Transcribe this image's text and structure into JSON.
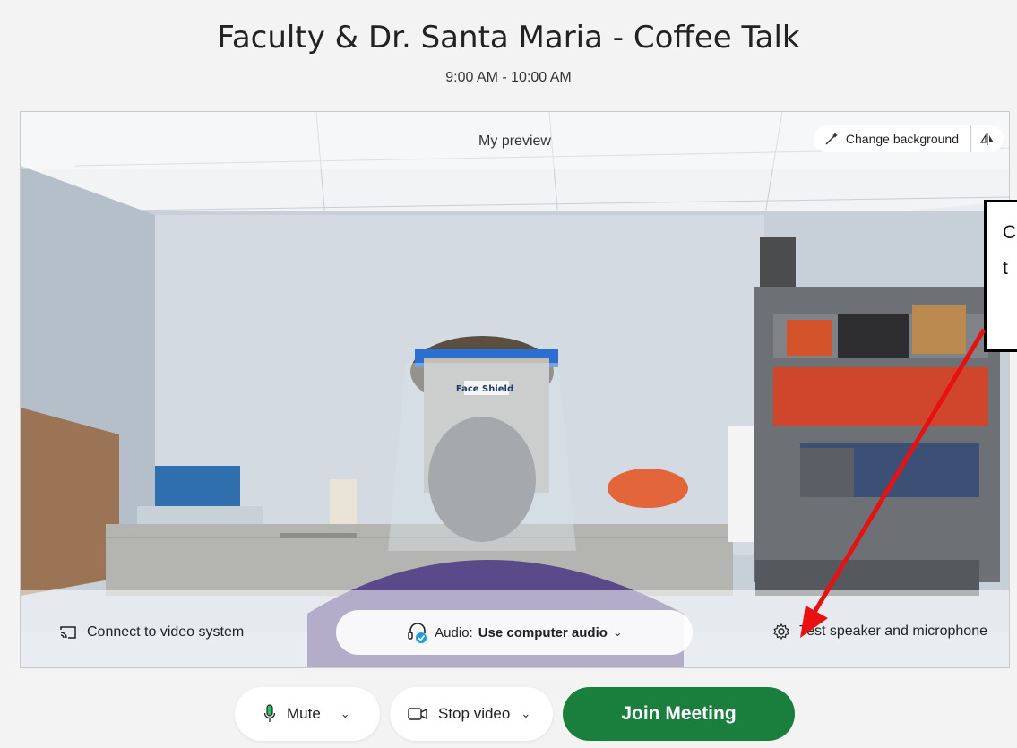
{
  "meeting": {
    "title": "Faculty & Dr. Santa Maria - Coffee Talk",
    "time": "9:00 AM - 10:00 AM"
  },
  "preview": {
    "label": "My preview",
    "change_background_label": "Change background",
    "mask_text": "Face Shield"
  },
  "footer": {
    "connect_label": "Connect to video system",
    "audio_prefix": "Audio:",
    "audio_value": "Use computer audio",
    "test_label": "Test speaker and microphone"
  },
  "controls": {
    "mute_label": "Mute",
    "stop_video_label": "Stop video",
    "join_label": "Join Meeting"
  },
  "callout": {
    "line1": "C",
    "line2": "t"
  },
  "colors": {
    "join_green": "#1a7f3c",
    "arrow_red": "#e81010",
    "audio_badge_blue": "#1e9be3"
  },
  "icons": [
    "magic-wand-icon",
    "mirror-icon",
    "cast-icon",
    "headset-icon",
    "gear-icon",
    "microphone-icon",
    "camera-icon",
    "chevron-down-icon"
  ]
}
